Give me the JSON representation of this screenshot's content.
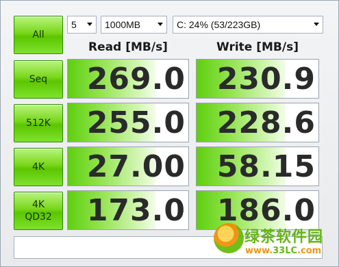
{
  "controls": {
    "all_label": "All",
    "count": "5",
    "size": "1000MB",
    "drive": "C: 24% (53/223GB)"
  },
  "columns": {
    "read": "Read [MB/s]",
    "write": "Write [MB/s]"
  },
  "rows": [
    {
      "label_line1": "Seq",
      "label_line2": "",
      "read": "269.0",
      "write": "230.9"
    },
    {
      "label_line1": "512K",
      "label_line2": "",
      "read": "255.0",
      "write": "228.6"
    },
    {
      "label_line1": "4K",
      "label_line2": "",
      "read": "27.00",
      "write": "58.15"
    },
    {
      "label_line1": "4K",
      "label_line2": "QD32",
      "read": "173.0",
      "write": "186.0"
    }
  ],
  "status": "",
  "watermark": {
    "brand": "绿茶软件园",
    "url_prefix": "www.",
    "url_mid": "33LC",
    "url_suffix": ".com"
  },
  "bar_fill_fraction": {
    "read": [
      0.73,
      0.73,
      0.73,
      0.73
    ],
    "write": [
      0.73,
      0.73,
      0.73,
      0.73
    ]
  },
  "colors": {
    "button_green": "#78d61a",
    "bar_green": "#5fcf10",
    "watermark_green": "#58b200",
    "watermark_orange": "#ef8d00"
  }
}
